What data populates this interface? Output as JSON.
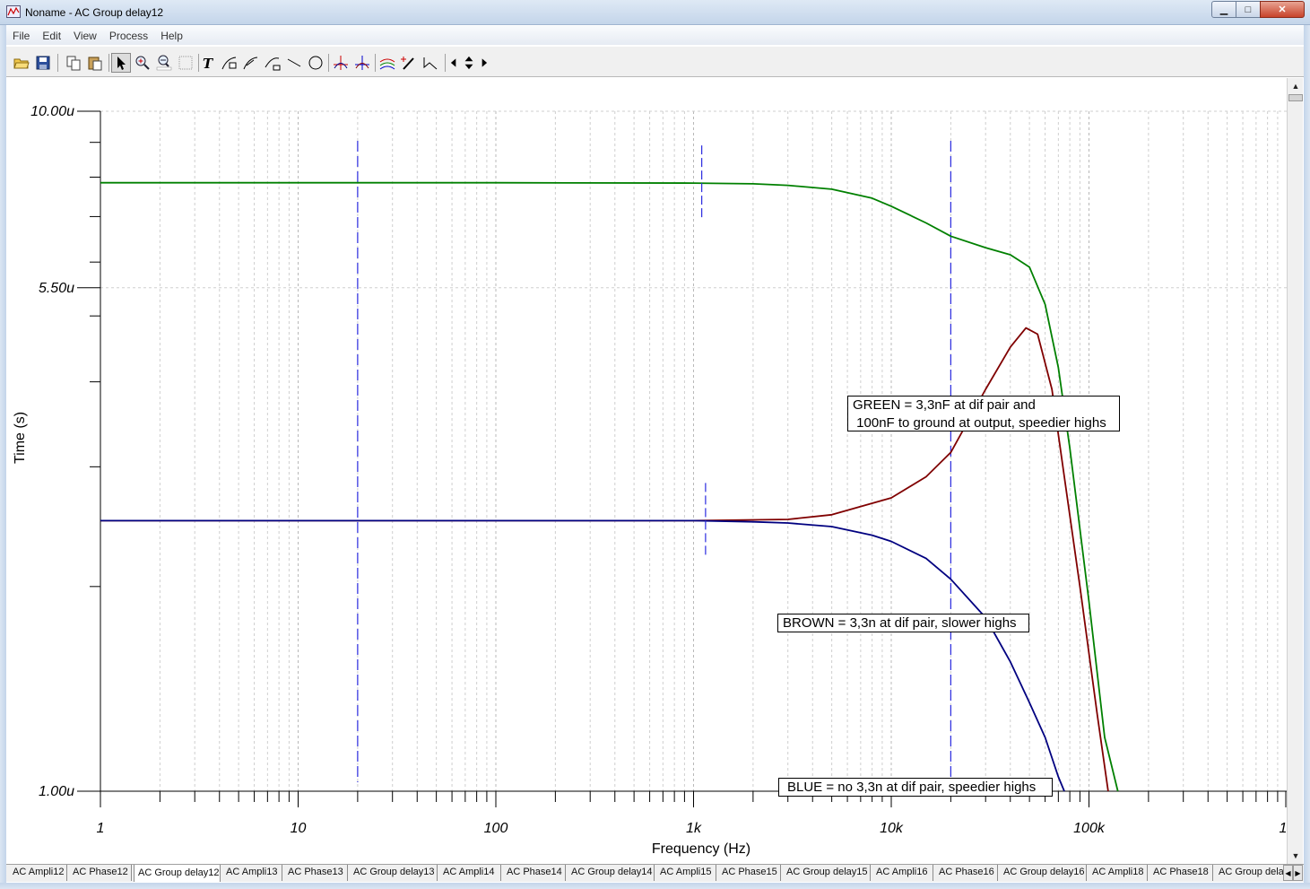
{
  "window": {
    "title": "Noname - AC Group delay12",
    "min_label": "▁",
    "max_label": "□",
    "close_label": "✕"
  },
  "menu": [
    "File",
    "Edit",
    "View",
    "Process",
    "Help"
  ],
  "toolbar": {
    "icons": [
      "open-folder-icon",
      "save-icon",
      "copy-icon",
      "paste-icon",
      "pointer-icon",
      "zoom-in-icon",
      "zoom-100-icon",
      "grid-icon",
      "text-icon",
      "curve-label-icon",
      "curve-label2-icon",
      "fit-icon",
      "line-icon",
      "circle-icon",
      "cursor-a-icon",
      "cursor-b-icon",
      "curves-icon",
      "probe-icon",
      "marker-icon",
      "arrow-left-icon",
      "arrow-updown-icon",
      "arrow-right-icon"
    ]
  },
  "chart_data": {
    "type": "line",
    "x_scale": "log",
    "y_scale": "log",
    "xlabel": "Frequency (Hz)",
    "ylabel": "Time (s)",
    "xlim": [
      1,
      1000000
    ],
    "x_ticks": [
      {
        "value": 1,
        "label": "1"
      },
      {
        "value": 10,
        "label": "10"
      },
      {
        "value": 100,
        "label": "100"
      },
      {
        "value": 1000,
        "label": "1k"
      },
      {
        "value": 10000,
        "label": "10k"
      },
      {
        "value": 100000,
        "label": "100k"
      },
      {
        "value": 1000000,
        "label": "1"
      }
    ],
    "ylim": [
      1e-06,
      1e-05
    ],
    "y_ticks": [
      {
        "value": 1e-05,
        "label": "10.00u"
      },
      {
        "value": 5.5e-06,
        "label": "5.50u"
      },
      {
        "value": 1e-06,
        "label": "1.00u"
      }
    ],
    "grid": true,
    "series": [
      {
        "color": "#008000",
        "x": [
          1,
          10,
          100,
          1000,
          2000,
          3000,
          5000,
          8000,
          10000,
          15000,
          20000,
          30000,
          40000,
          50000,
          60000,
          70000,
          80000,
          100000,
          120000,
          140000
        ],
        "y": [
          7.85e-06,
          7.85e-06,
          7.85e-06,
          7.84e-06,
          7.82e-06,
          7.78e-06,
          7.68e-06,
          7.45e-06,
          7.25e-06,
          6.85e-06,
          6.55e-06,
          6.3e-06,
          6.15e-06,
          5.9e-06,
          5.2e-06,
          4.2e-06,
          3.2e-06,
          1.9e-06,
          1.2e-06,
          1e-06
        ]
      },
      {
        "color": "#800000",
        "x": [
          1,
          10,
          100,
          1000,
          3000,
          5000,
          10000,
          15000,
          20000,
          30000,
          40000,
          48000,
          55000,
          65000,
          75000,
          90000,
          110000,
          125000
        ],
        "y": [
          2.5e-06,
          2.5e-06,
          2.5e-06,
          2.5e-06,
          2.51e-06,
          2.55e-06,
          2.7e-06,
          2.9e-06,
          3.15e-06,
          3.9e-06,
          4.5e-06,
          4.8e-06,
          4.7e-06,
          3.9e-06,
          2.9e-06,
          2e-06,
          1.3e-06,
          1e-06
        ]
      },
      {
        "color": "#000080",
        "x": [
          1,
          10,
          100,
          1000,
          2000,
          3000,
          5000,
          8000,
          10000,
          15000,
          20000,
          30000,
          40000,
          50000,
          60000,
          70000,
          75000
        ],
        "y": [
          2.5e-06,
          2.5e-06,
          2.5e-06,
          2.5e-06,
          2.49e-06,
          2.48e-06,
          2.45e-06,
          2.38e-06,
          2.33e-06,
          2.2e-06,
          2.05e-06,
          1.8e-06,
          1.55e-06,
          1.35e-06,
          1.2e-06,
          1.05e-06,
          1e-06
        ]
      }
    ],
    "cursors": [
      20,
      20000
    ],
    "markers": [
      {
        "x": 1100,
        "y": 7.84e-06
      },
      {
        "x": 1150,
        "y": 2.5e-06
      }
    ],
    "annotations": [
      {
        "text": "GREEN = 3,3nF at dif pair and\n 100nF to ground at output, speedier highs"
      },
      {
        "text": "BROWN = 3,3n at dif pair, slower highs"
      },
      {
        "text": "BLUE = no 3,3n at dif pair, speedier highs"
      }
    ]
  },
  "tabs": [
    "AC Ampli12",
    "AC Phase12",
    "AC Group delay12",
    "AC Ampli13",
    "AC Phase13",
    "AC Group delay13",
    "AC Ampli14",
    "AC Phase14",
    "AC Group delay14",
    "AC Ampli15",
    "AC Phase15",
    "AC Group delay15",
    "AC Ampli16",
    "AC Phase16",
    "AC Group delay16",
    "AC Ampli18",
    "AC Phase18",
    "AC Group delay18"
  ],
  "active_tab": "AC Group delay12"
}
